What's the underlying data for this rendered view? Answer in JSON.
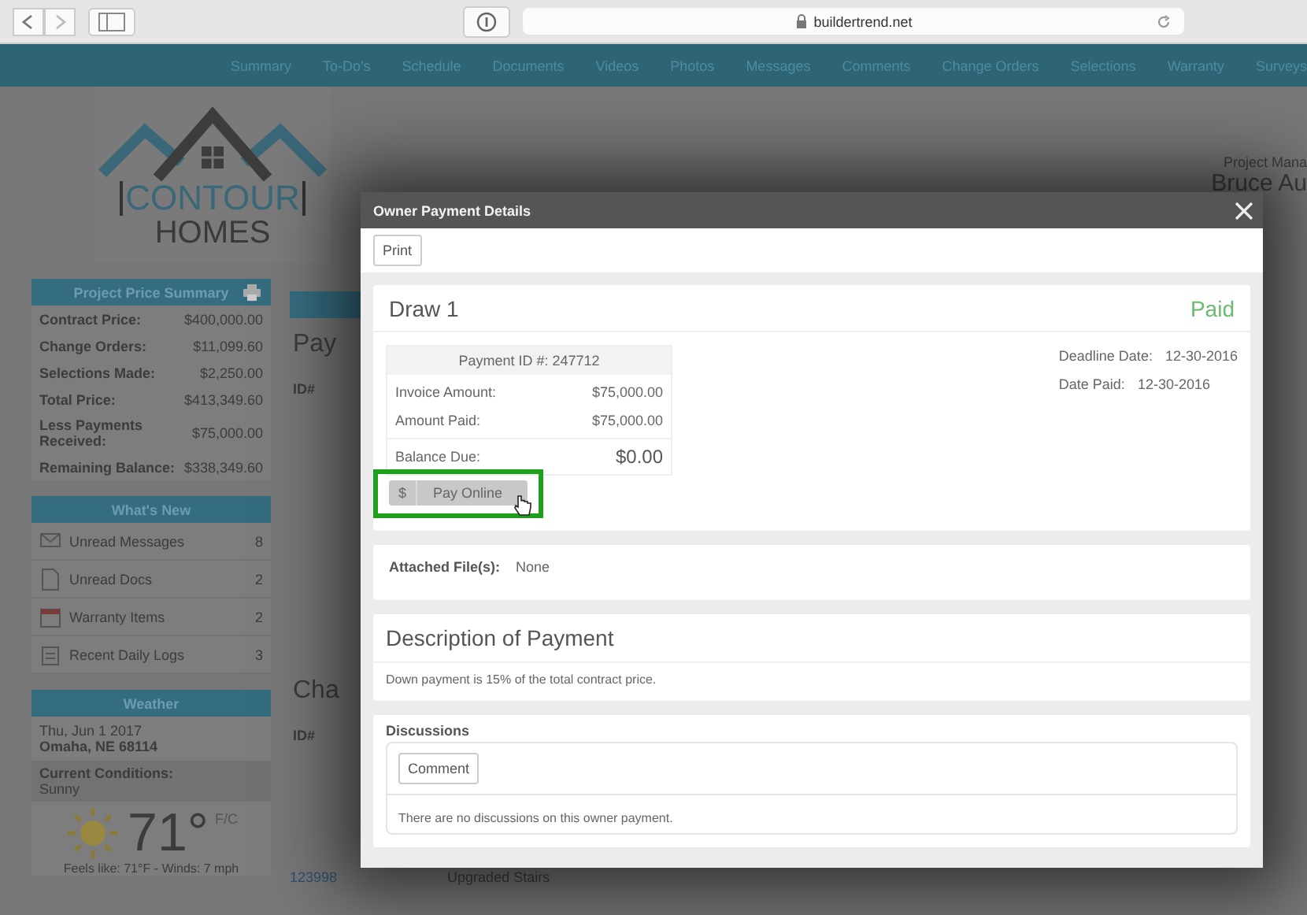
{
  "browser": {
    "url": "buildertrend.net"
  },
  "nav": {
    "items": [
      {
        "label": "Summary"
      },
      {
        "label": "To-Do's"
      },
      {
        "label": "Schedule"
      },
      {
        "label": "Documents"
      },
      {
        "label": "Videos"
      },
      {
        "label": "Photos"
      },
      {
        "label": "Messages"
      },
      {
        "label": "Comments"
      },
      {
        "label": "Change Orders"
      },
      {
        "label": "Selections"
      },
      {
        "label": "Warranty"
      },
      {
        "label": "Surveys"
      }
    ]
  },
  "logo": {
    "line_1": "CONTOUR",
    "line_2": "HOMES"
  },
  "project_manager": {
    "label": "Project Mana",
    "name": "Bruce Au"
  },
  "price_summary": {
    "title": "Project Price Summary",
    "rows": [
      {
        "label": "Contract Price:",
        "value": "$400,000.00"
      },
      {
        "label": "Change Orders:",
        "value": "$11,099.60"
      },
      {
        "label": "Selections Made:",
        "value": "$2,250.00"
      },
      {
        "label": "Total Price:",
        "value": "$413,349.60"
      },
      {
        "label": "Less Payments Received:",
        "value": "$75,000.00"
      },
      {
        "label": "Remaining Balance:",
        "value": "$338,349.60"
      }
    ]
  },
  "whats_new": {
    "title": "What's New",
    "items": [
      {
        "kind": "messages",
        "label": "Unread Messages",
        "count": "8"
      },
      {
        "kind": "docs",
        "label": "Unread Docs",
        "count": "2"
      },
      {
        "kind": "warranty",
        "label": "Warranty Items",
        "count": "2"
      },
      {
        "kind": "logs",
        "label": "Recent Daily Logs",
        "count": "3"
      }
    ]
  },
  "weather": {
    "title": "Weather",
    "date": "Thu, Jun 1 2017",
    "location": "Omaha, NE 68114",
    "conditions_label": "Current Conditions:",
    "conditions": "Sunny",
    "temperature": "71°",
    "units": "F/C",
    "details": "Feels like: 71°F - Winds: 7 mph"
  },
  "background_sections": [
    {
      "heading": "Pay",
      "column": "ID#"
    },
    {
      "heading": "Cha",
      "column": "ID#"
    }
  ],
  "background_row": {
    "id": "123998",
    "title": "Upgraded Stairs"
  },
  "modal": {
    "title": "Owner Payment Details",
    "toolbar": [
      "Print"
    ],
    "draw": {
      "title": "Draw 1",
      "status": "Paid",
      "payment_id": "Payment ID #: 247712",
      "rows": [
        {
          "label": "Invoice Amount:",
          "value": "$75,000.00"
        },
        {
          "label": "Amount Paid:",
          "value": "$75,000.00"
        }
      ],
      "balance": {
        "label": "Balance Due:",
        "value": "$0.00"
      },
      "dates": [
        {
          "label": "Deadline Date:",
          "value": "12-30-2016"
        },
        {
          "label": "Date Paid:",
          "value": "12-30-2016"
        }
      ],
      "pay_button": {
        "icon": "$",
        "label": "Pay Online",
        "highlighted": true
      }
    },
    "attached": {
      "label": "Attached File(s):",
      "value": "None"
    },
    "description": {
      "title": "Description of Payment",
      "text": "Down payment is 15% of the total contract price."
    },
    "discussions": {
      "title": "Discussions",
      "button": "Comment",
      "empty": "There are no discussions on this owner payment."
    }
  }
}
